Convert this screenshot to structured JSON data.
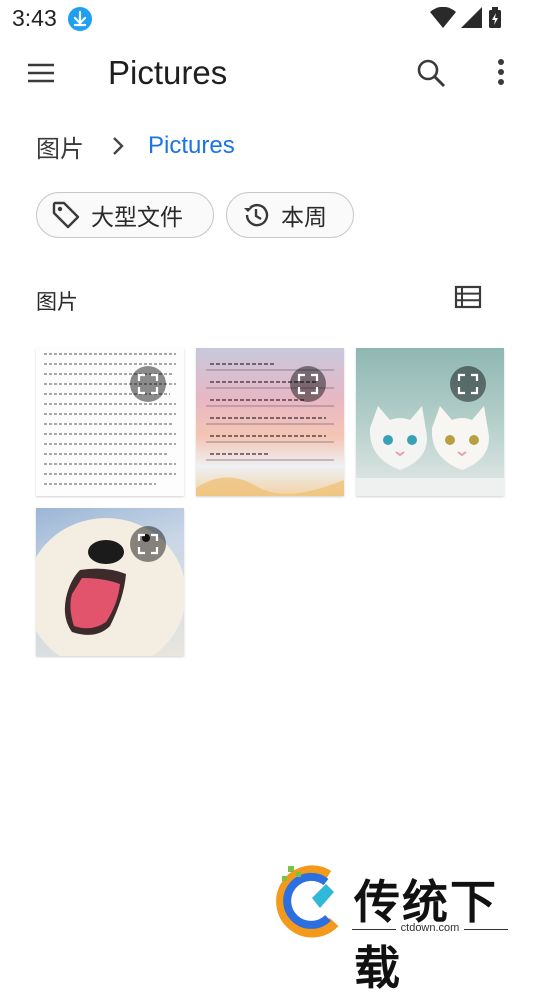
{
  "status_bar": {
    "time": "3:43",
    "icons": [
      "download-icon",
      "wifi-icon",
      "signal-icon",
      "battery-icon"
    ]
  },
  "toolbar": {
    "title": "Pictures",
    "icons": [
      "menu-icon",
      "search-icon",
      "more-vert-icon"
    ]
  },
  "breadcrumb": {
    "root": "图片",
    "current": "Pictures"
  },
  "chips": [
    {
      "label": "大型文件",
      "icon": "tag-icon"
    },
    {
      "label": "本周",
      "icon": "history-icon"
    }
  ],
  "section": {
    "title": "图片",
    "view_icon": "list-view-icon"
  },
  "thumbnails": [
    {
      "kind": "handwritten-text-page"
    },
    {
      "kind": "sunset-greeting-card"
    },
    {
      "kind": "two-white-kittens"
    },
    {
      "kind": "white-puppy"
    }
  ],
  "watermark": {
    "text": "传统下载",
    "sub": "ctdown.com"
  },
  "colors": {
    "accent": "#1a73e8",
    "badge": "#1ea0f2"
  }
}
